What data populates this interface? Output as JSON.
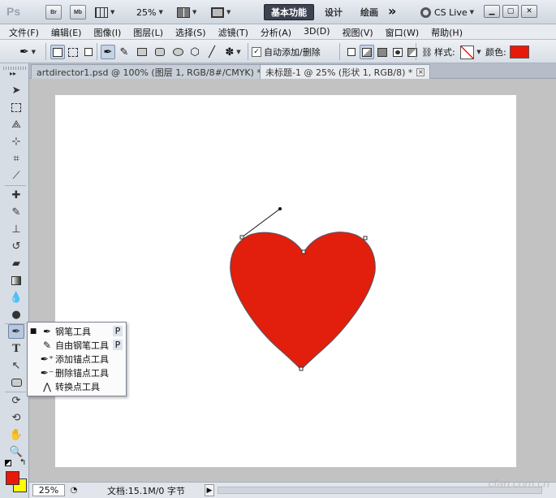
{
  "app": {
    "logo": "Ps",
    "br": "Br",
    "mb": "Mb",
    "zoom": "25%",
    "workspaces": [
      "基本功能",
      "设计",
      "绘画"
    ],
    "more": "»",
    "cslive": "CS Live"
  },
  "menu": [
    "文件(F)",
    "编辑(E)",
    "图像(I)",
    "图层(L)",
    "选择(S)",
    "滤镜(T)",
    "分析(A)",
    "3D(D)",
    "视图(V)",
    "窗口(W)",
    "帮助(H)"
  ],
  "options": {
    "auto_add_delete_label": "自动添加/删除",
    "auto_add_delete_checked": "✓",
    "style_label": "样式:",
    "color_label": "颜色:",
    "color_value": "#e8190a"
  },
  "tabs": [
    {
      "label": "artdirector1.psd @ 100% (图层 1, RGB/8#/CMYK) *",
      "close": "×"
    },
    {
      "label": "未标题-1 @ 25% (形状 1, RGB/8) *",
      "close": "×"
    }
  ],
  "flyout": [
    {
      "bullet": "■",
      "label": "钢笔工具",
      "key": "P",
      "icon": "pen-icon"
    },
    {
      "bullet": "",
      "label": "自由钢笔工具",
      "key": "P",
      "icon": "freeform-pen-icon"
    },
    {
      "bullet": "",
      "label": "添加锚点工具",
      "key": "",
      "icon": "add-anchor-icon"
    },
    {
      "bullet": "",
      "label": "删除锚点工具",
      "key": "",
      "icon": "delete-anchor-icon"
    },
    {
      "bullet": "",
      "label": "转换点工具",
      "key": "",
      "icon": "convert-point-icon"
    }
  ],
  "status": {
    "zoom": "25%",
    "doc_info": "文档:15.1M/0 字节"
  },
  "colors": {
    "foreground": "#e8190a",
    "background": "#ffff00",
    "heart": "#e11f0c"
  },
  "watermark": "cfan.com.cn"
}
